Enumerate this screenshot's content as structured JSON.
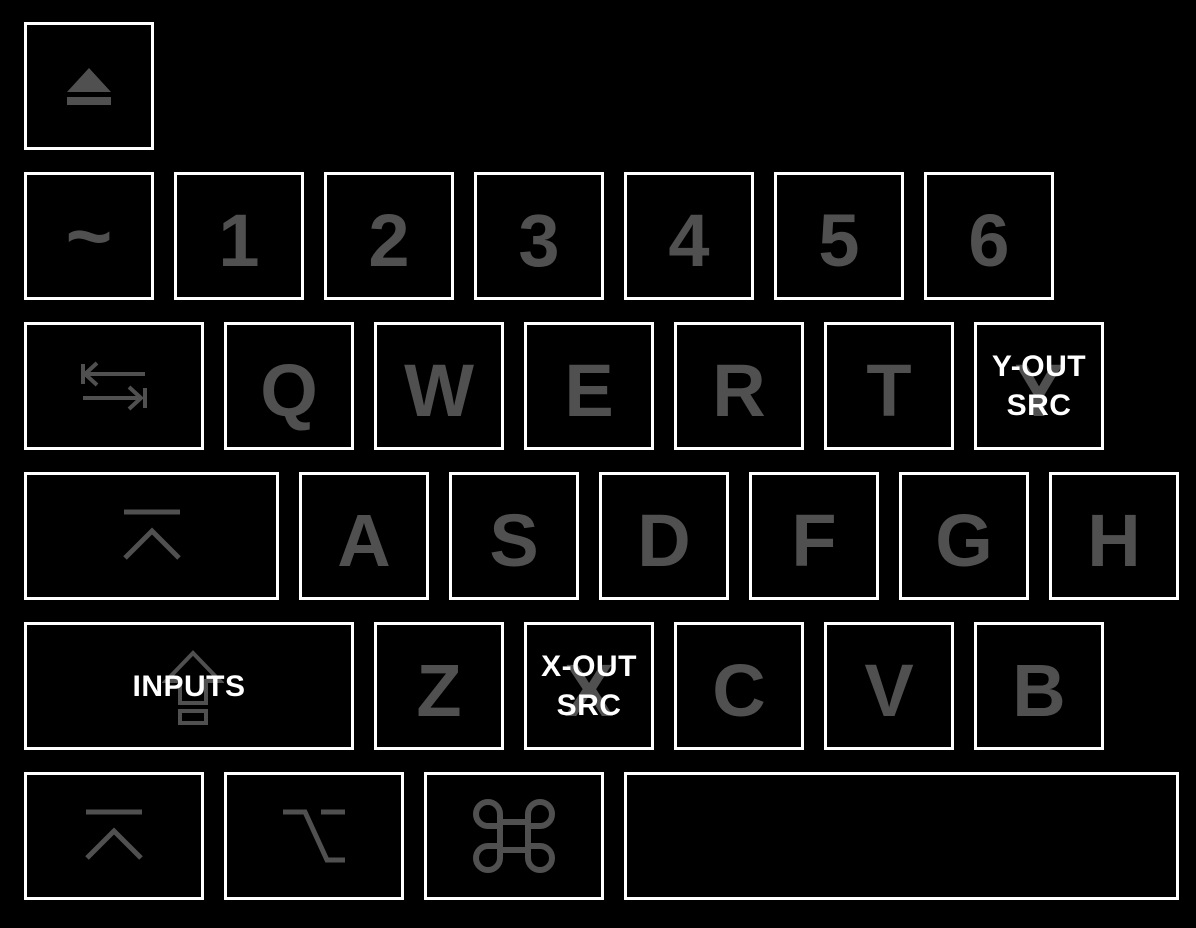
{
  "keyboard": {
    "eject": {
      "icon": "eject-icon"
    },
    "row1": {
      "tilde": "~",
      "k1": "1",
      "k2": "2",
      "k3": "3",
      "k4": "4",
      "k5": "5",
      "k6": "6"
    },
    "row2": {
      "tab": {
        "icon": "tab-arrows-icon"
      },
      "q": "Q",
      "w": "W",
      "e": "E",
      "r": "R",
      "t": "T",
      "y": "Y",
      "y_overlay": "Y-OUT\nSRC"
    },
    "row3": {
      "control": {
        "icon": "control-caret-icon"
      },
      "a": "A",
      "s": "S",
      "d": "D",
      "f": "F",
      "g": "G",
      "h": "H"
    },
    "row4": {
      "shift": {
        "icon": "shift-arrow-icon"
      },
      "shift_overlay": "INPUTS",
      "z": "Z",
      "x": "X",
      "x_overlay": "X-OUT\nSRC",
      "c": "C",
      "v": "V",
      "b": "B"
    },
    "row5": {
      "control": {
        "icon": "control-caret-icon"
      },
      "option": {
        "icon": "option-icon"
      },
      "command": {
        "icon": "command-icon"
      },
      "space": ""
    },
    "colors": {
      "background": "#000000",
      "border": "#ffffff",
      "legend": "#505050",
      "overlay": "#ffffff"
    }
  }
}
